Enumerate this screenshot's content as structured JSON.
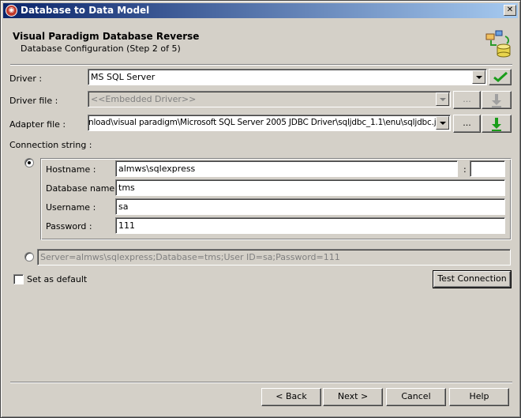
{
  "window": {
    "title": "Database to Data Model"
  },
  "header": {
    "title": "Visual Paradigm Database Reverse",
    "subtitle": "Database Configuration (Step 2 of 5)"
  },
  "driver": {
    "label": "Driver :",
    "value": "MS SQL Server"
  },
  "driver_file": {
    "label": "Driver file :",
    "value": "<<Embedded Driver>>",
    "browse_label": "..."
  },
  "adapter_file": {
    "label": "Adapter file :",
    "value": "nload\\visual paradigm\\Microsoft SQL Server 2005 JDBC Driver\\sqljdbc_1.1\\enu\\sqljdbc.jar",
    "browse_label": "..."
  },
  "connection": {
    "label": "Connection string :",
    "hostname_label": "Hostname :",
    "hostname": "almws\\sqlexpress",
    "port_sep": ":",
    "port": "",
    "database_label": "Database name :",
    "database": "tms",
    "username_label": "Username :",
    "username": "sa",
    "password_label": "Password :",
    "password": "111",
    "raw_string": "Server=almws\\sqlexpress;Database=tms;User ID=sa;Password=111"
  },
  "options": {
    "set_default_label": "Set as default",
    "test_connection_label": "Test Connection"
  },
  "footer": {
    "back_label": "< Back",
    "next_label": "Next >",
    "cancel_label": "Cancel",
    "help_label": "Help"
  },
  "colors": {
    "title_bar_start": "#0a246a",
    "title_bar_end": "#a6caf0",
    "window_bg": "#d4d0c8",
    "ok_green": "#1a9d1a"
  }
}
